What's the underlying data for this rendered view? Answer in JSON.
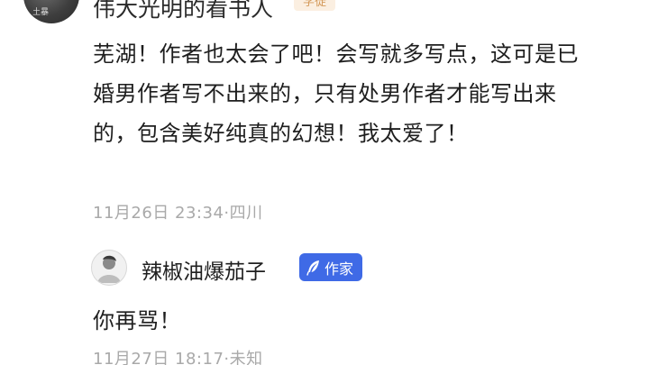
{
  "top_comment": {
    "avatar_badge": "土暴",
    "username": "伟大光明的看书人",
    "tag": "学徒"
  },
  "comment": {
    "text": "芜湖！作者也太会了吧！会写就多写点，这可是已婚男作者写不出来的，只有处男作者才能写出来的，包含美好纯真的幻想！我太爱了！",
    "meta": "11月26日 23:34·四川"
  },
  "reply": {
    "username": "辣椒油爆茄子",
    "badge_label": "作家",
    "badge_icon": "feather-icon",
    "badge_color": "#3f6ae6",
    "text": "你再骂！",
    "meta": "11月27日 18:17·未知"
  }
}
